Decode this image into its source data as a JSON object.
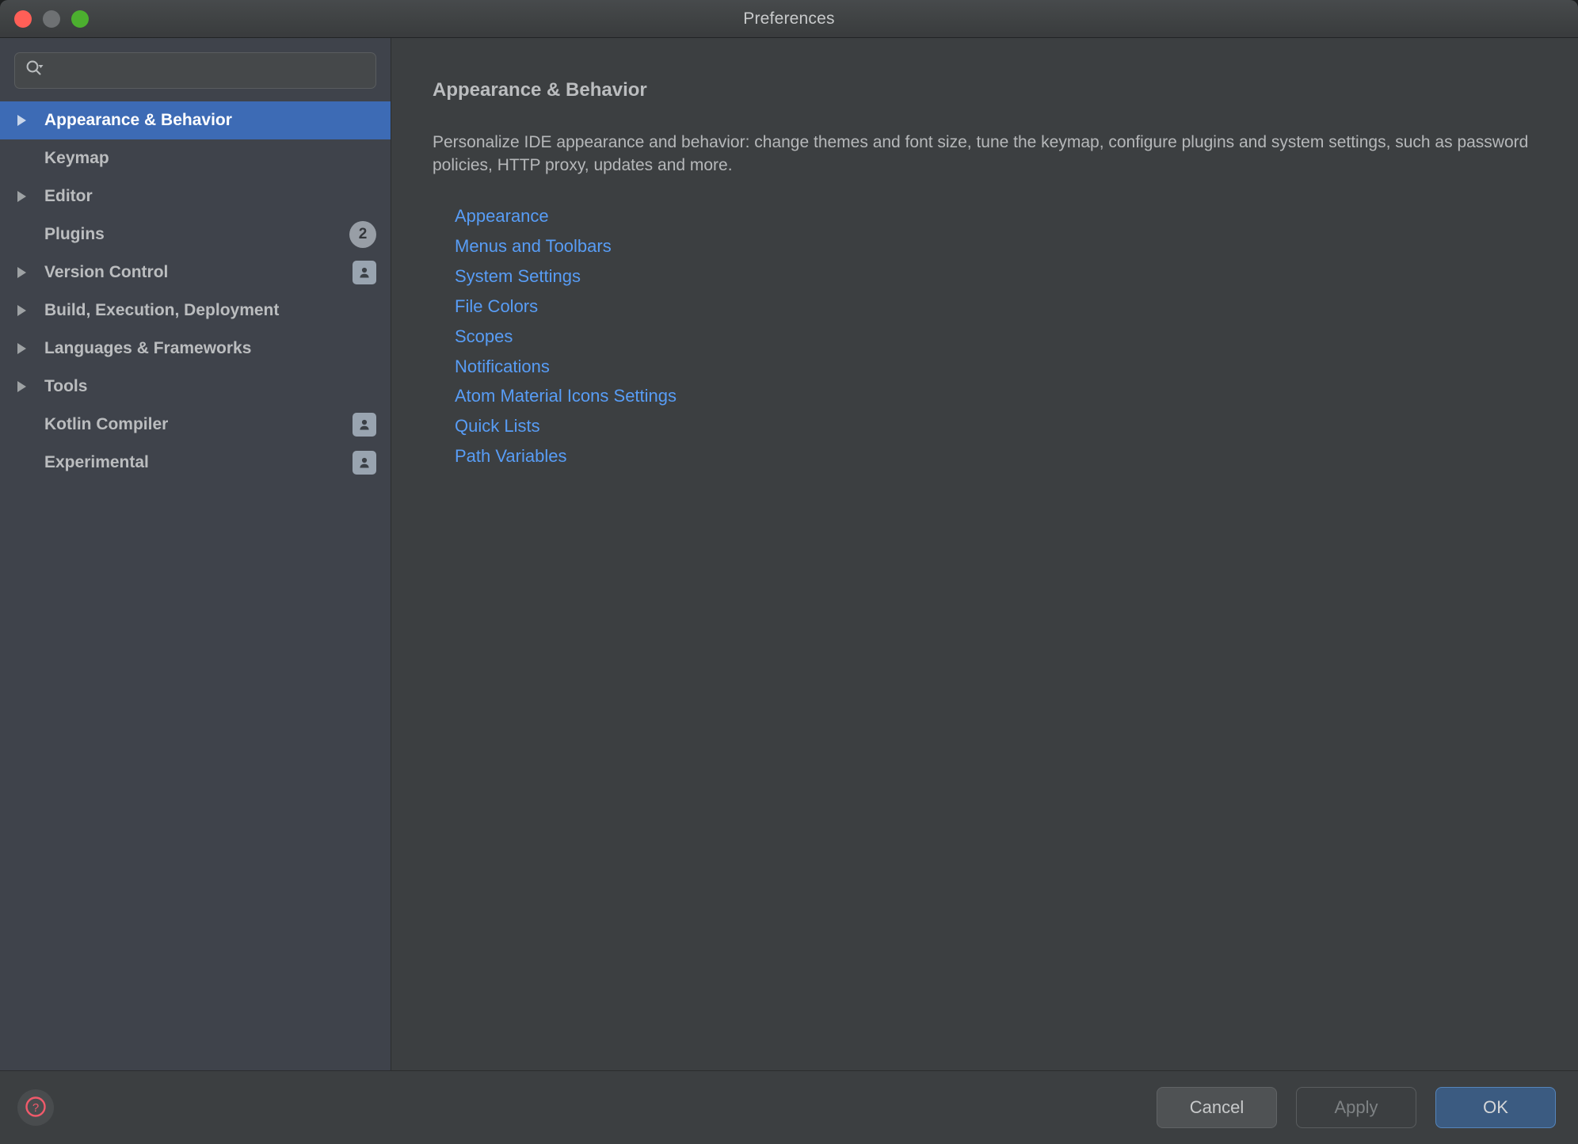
{
  "window": {
    "title": "Preferences",
    "traffic_lights": [
      "close-button",
      "minimize-button",
      "zoom-button"
    ]
  },
  "sidebar": {
    "search": {
      "placeholder": "",
      "value": "",
      "icon": "search-icon"
    },
    "items": [
      {
        "label": "Appearance & Behavior",
        "expandable": true,
        "selected": true,
        "badge": null
      },
      {
        "label": "Keymap",
        "expandable": false,
        "selected": false,
        "badge": null
      },
      {
        "label": "Editor",
        "expandable": true,
        "selected": false,
        "badge": null
      },
      {
        "label": "Plugins",
        "expandable": false,
        "selected": false,
        "badge": {
          "type": "count",
          "value": "2"
        }
      },
      {
        "label": "Version Control",
        "expandable": true,
        "selected": false,
        "badge": {
          "type": "user-icon",
          "value": ""
        }
      },
      {
        "label": "Build, Execution, Deployment",
        "expandable": true,
        "selected": false,
        "badge": null
      },
      {
        "label": "Languages & Frameworks",
        "expandable": true,
        "selected": false,
        "badge": null
      },
      {
        "label": "Tools",
        "expandable": true,
        "selected": false,
        "badge": null
      },
      {
        "label": "Kotlin Compiler",
        "expandable": false,
        "selected": false,
        "badge": {
          "type": "user-icon",
          "value": ""
        }
      },
      {
        "label": "Experimental",
        "expandable": false,
        "selected": false,
        "badge": {
          "type": "user-icon",
          "value": ""
        }
      }
    ]
  },
  "main": {
    "title": "Appearance & Behavior",
    "description": "Personalize IDE appearance and behavior: change themes and font size, tune the keymap, configure plugins and system settings, such as password policies, HTTP proxy, updates and more.",
    "links": [
      "Appearance",
      "Menus and Toolbars",
      "System Settings",
      "File Colors",
      "Scopes",
      "Notifications",
      "Atom Material Icons Settings",
      "Quick Lists",
      "Path Variables"
    ]
  },
  "footer": {
    "help_label": "?",
    "cancel_label": "Cancel",
    "apply_label": "Apply",
    "apply_enabled": false,
    "ok_label": "OK"
  },
  "colors": {
    "selection_blue": "#3d6bb5",
    "link_blue": "#589df6",
    "ok_button_blue": "#3b5b81",
    "sidebar_bg": "#3f434b",
    "panel_bg": "#3c3f41",
    "help_red": "#f05a6b",
    "traffic_red": "#ff5f57",
    "traffic_yellow": "#6e7173",
    "traffic_green": "#4caf2f"
  }
}
